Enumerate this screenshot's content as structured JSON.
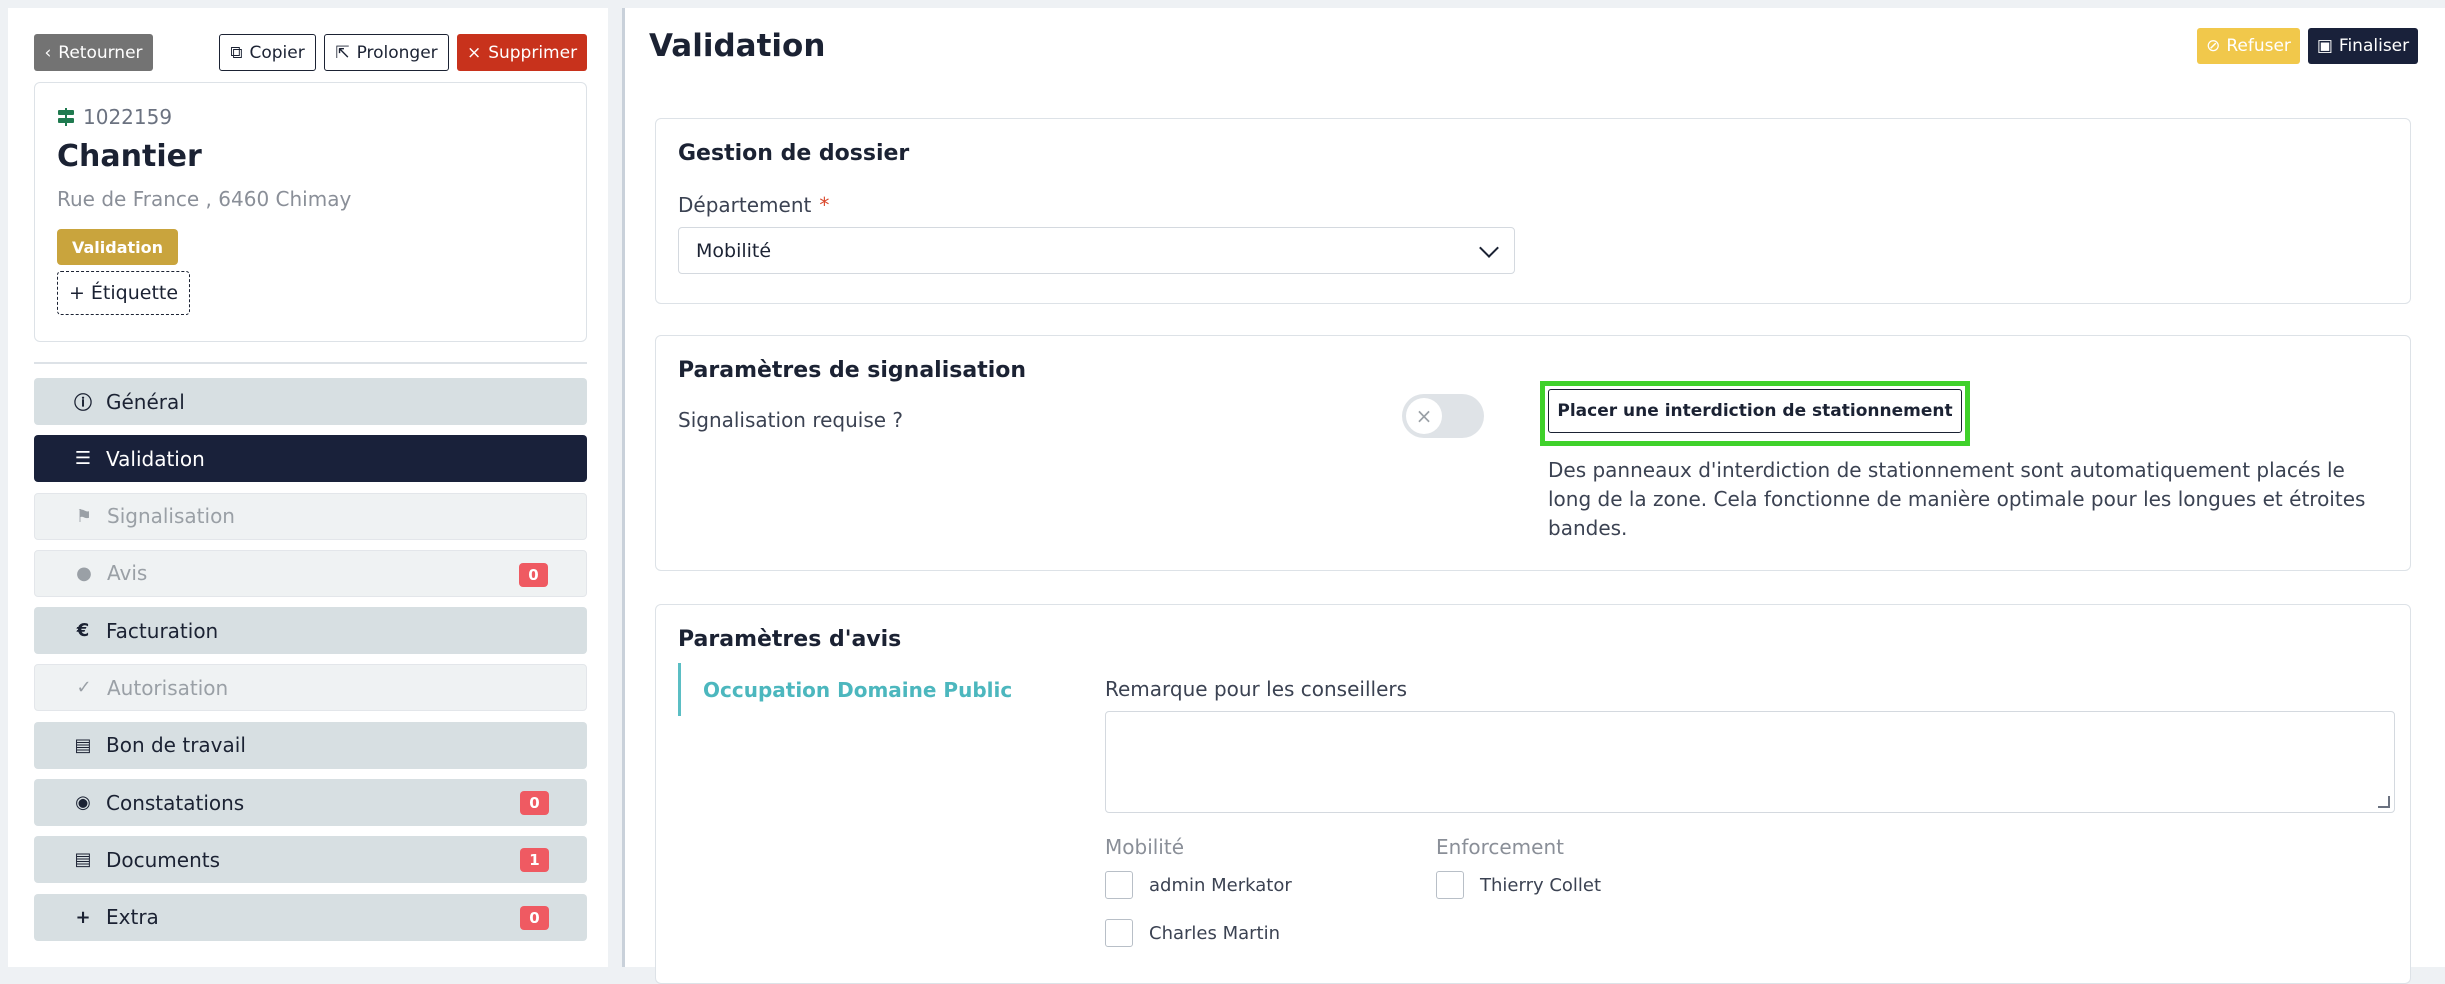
{
  "sidebar": {
    "back_label": "Retourner",
    "copy_label": "Copier",
    "prolong_label": "Prolonger",
    "delete_label": "Supprimer",
    "record": {
      "id": "1022159",
      "title": "Chantier",
      "address": "Rue de France , 6460 Chimay",
      "status": "Validation",
      "tag_button": "+ Étiquette"
    },
    "nav": [
      {
        "label": "Général",
        "icon": "info-icon",
        "state": "normal",
        "count": null
      },
      {
        "label": "Validation",
        "icon": "checklist-icon",
        "state": "active",
        "count": null
      },
      {
        "label": "Signalisation",
        "icon": "signpost-icon",
        "state": "disabled",
        "count": null
      },
      {
        "label": "Avis",
        "icon": "chat-icon",
        "state": "disabled",
        "count": "0"
      },
      {
        "label": "Facturation",
        "icon": "euro-icon",
        "state": "normal",
        "count": null
      },
      {
        "label": "Autorisation",
        "icon": "file-check-icon",
        "state": "disabled",
        "count": null
      },
      {
        "label": "Bon de travail",
        "icon": "file-icon",
        "state": "normal",
        "count": null
      },
      {
        "label": "Constatations",
        "icon": "eye-icon",
        "state": "normal",
        "count": "0"
      },
      {
        "label": "Documents",
        "icon": "document-icon",
        "state": "normal",
        "count": "1"
      },
      {
        "label": "Extra",
        "icon": "plus-icon",
        "state": "normal",
        "count": "0"
      }
    ]
  },
  "main": {
    "title": "Validation",
    "refuse_label": "Refuser",
    "finalize_label": "Finaliser",
    "dossier": {
      "title": "Gestion de dossier",
      "department_label": "Département",
      "required_mark": "*",
      "department_value": "Mobilité"
    },
    "signal": {
      "title": "Paramètres de signalisation",
      "question": "Signalisation requise ?",
      "toggle_state": "off",
      "place_button": "Placer une interdiction de stationnement",
      "help": "Des panneaux d'interdiction de stationnement sont automatiquement placés le long de la zone. Cela fonctionne de manière optimale pour les longues et étroites bandes."
    },
    "avis": {
      "title": "Paramètres d'avis",
      "section": "Occupation Domaine Public",
      "remark_label": "Remarque pour les conseillers",
      "remark_value": "",
      "groups": [
        {
          "label": "Mobilité",
          "members": [
            "admin Merkator",
            "Charles Martin"
          ]
        },
        {
          "label": "Enforcement",
          "members": [
            "Thierry Collet"
          ]
        }
      ]
    }
  },
  "colors": {
    "navy": "#19213a",
    "gold": "#c9a43d",
    "danger": "#c8321c",
    "warning": "#f1c84b",
    "teal": "#4cb7be",
    "badge": "#ef5a62",
    "highlight": "#3fd12b"
  }
}
